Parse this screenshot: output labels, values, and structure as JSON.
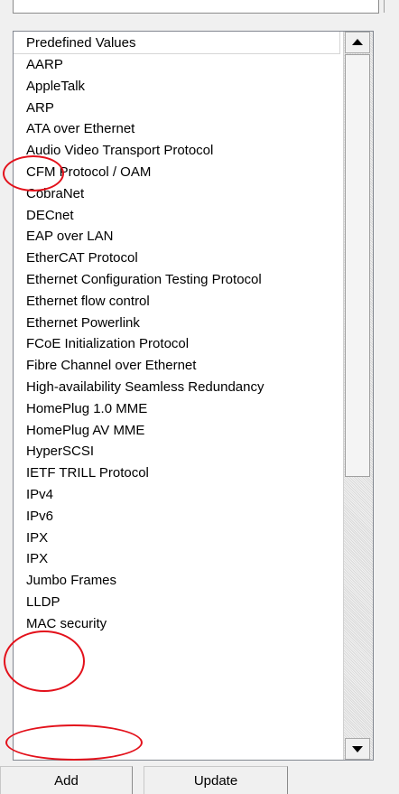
{
  "list": {
    "header": "Predefined Values",
    "items": [
      "AARP",
      "AppleTalk",
      "ARP",
      "ATA over Ethernet",
      "Audio Video Transport Protocol",
      "CFM Protocol / OAM",
      "CobraNet",
      "DECnet",
      "EAP over LAN",
      "EtherCAT Protocol",
      "Ethernet Configuration Testing Protocol",
      "Ethernet flow control",
      "Ethernet Powerlink",
      "FCoE Initialization Protocol",
      "Fibre Channel over Ethernet",
      "High-availability Seamless Redundancy",
      "HomePlug 1.0 MME",
      "HomePlug AV MME",
      "HyperSCSI",
      "IETF TRILL Protocol",
      "IPv4",
      "IPv6",
      "IPX",
      "IPX",
      "Jumbo Frames",
      "LLDP",
      "MAC security"
    ]
  },
  "scrollbar": {
    "up_icon": "arrow-up-icon",
    "down_icon": "arrow-down-icon"
  },
  "buttons": {
    "add": "Add",
    "update": "Update"
  },
  "annotations": {
    "color": "#e3111b"
  }
}
